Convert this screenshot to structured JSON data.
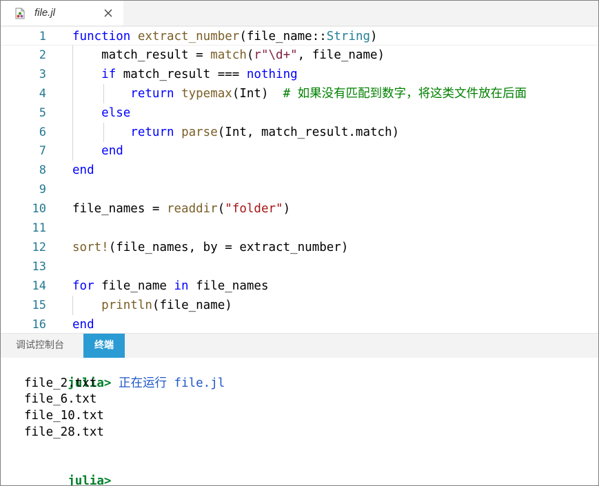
{
  "tab": {
    "title": "file.jl",
    "icon": "julia-file-icon",
    "close_icon": "close-icon"
  },
  "editor": {
    "lines": [
      {
        "n": "1",
        "tokens": [
          [
            "kw",
            "function"
          ],
          [
            "",
            " "
          ],
          [
            "fn",
            "extract_number"
          ],
          [
            "",
            "(file_name::"
          ],
          [
            "ty",
            "String"
          ],
          [
            "",
            ")"
          ]
        ]
      },
      {
        "n": "2",
        "tokens": [
          [
            "",
            "    match_result = "
          ],
          [
            "fn",
            "match"
          ],
          [
            "",
            "("
          ],
          [
            "rx",
            "r\"\\d+\""
          ],
          [
            "",
            ", file_name)"
          ]
        ]
      },
      {
        "n": "3",
        "tokens": [
          [
            "",
            "    "
          ],
          [
            "kw",
            "if"
          ],
          [
            "",
            ""
          ],
          [
            "",
            " match_result === "
          ],
          [
            "kw",
            "nothing"
          ]
        ]
      },
      {
        "n": "4",
        "tokens": [
          [
            "",
            "        "
          ],
          [
            "kw",
            "return"
          ],
          [
            "",
            " "
          ],
          [
            "fn",
            "typemax"
          ],
          [
            "",
            "(Int)  "
          ],
          [
            "cm",
            "# 如果没有匹配到数字，将这类文件放在后面"
          ]
        ]
      },
      {
        "n": "5",
        "tokens": [
          [
            "",
            "    "
          ],
          [
            "kw",
            "else"
          ]
        ]
      },
      {
        "n": "6",
        "tokens": [
          [
            "",
            "        "
          ],
          [
            "kw",
            "return"
          ],
          [
            "",
            " "
          ],
          [
            "fn",
            "parse"
          ],
          [
            "",
            "(Int, match_result.match)"
          ]
        ]
      },
      {
        "n": "7",
        "tokens": [
          [
            "",
            "    "
          ],
          [
            "kw",
            "end"
          ]
        ]
      },
      {
        "n": "8",
        "tokens": [
          [
            "kw",
            "end"
          ]
        ]
      },
      {
        "n": "9",
        "tokens": []
      },
      {
        "n": "10",
        "tokens": [
          [
            "",
            "file_names = "
          ],
          [
            "fn",
            "readdir"
          ],
          [
            "",
            "("
          ],
          [
            "str",
            "\"folder\""
          ],
          [
            "",
            ")"
          ]
        ]
      },
      {
        "n": "11",
        "tokens": []
      },
      {
        "n": "12",
        "tokens": [
          [
            "fn",
            "sort!"
          ],
          [
            "",
            "(file_names, by = extract_number)"
          ]
        ]
      },
      {
        "n": "13",
        "tokens": []
      },
      {
        "n": "14",
        "tokens": [
          [
            "kw",
            "for"
          ],
          [
            "",
            " file_name "
          ],
          [
            "kw",
            "in"
          ],
          [
            "",
            " file_names"
          ]
        ]
      },
      {
        "n": "15",
        "tokens": [
          [
            "",
            "    "
          ],
          [
            "fn",
            "println"
          ],
          [
            "",
            "(file_name)"
          ]
        ]
      },
      {
        "n": "16",
        "tokens": [
          [
            "kw",
            "end"
          ]
        ]
      }
    ]
  },
  "panel": {
    "tabs": [
      {
        "label": "调试控制台",
        "active": false
      },
      {
        "label": "终端",
        "active": true
      }
    ]
  },
  "terminal": {
    "prompt": "julia>",
    "run_text": " 正在运行 file.jl",
    "output": [
      "file_2.txt",
      "file_6.txt",
      "file_10.txt",
      "file_28.txt"
    ],
    "final_prompt": "julia>"
  },
  "colors": {
    "keyword": "#0000ff",
    "function": "#795e26",
    "string": "#a31515",
    "type": "#267f99",
    "comment": "#008000",
    "line_number": "#237893",
    "active_tab": "#2b9bd3",
    "prompt": "#00802b"
  }
}
